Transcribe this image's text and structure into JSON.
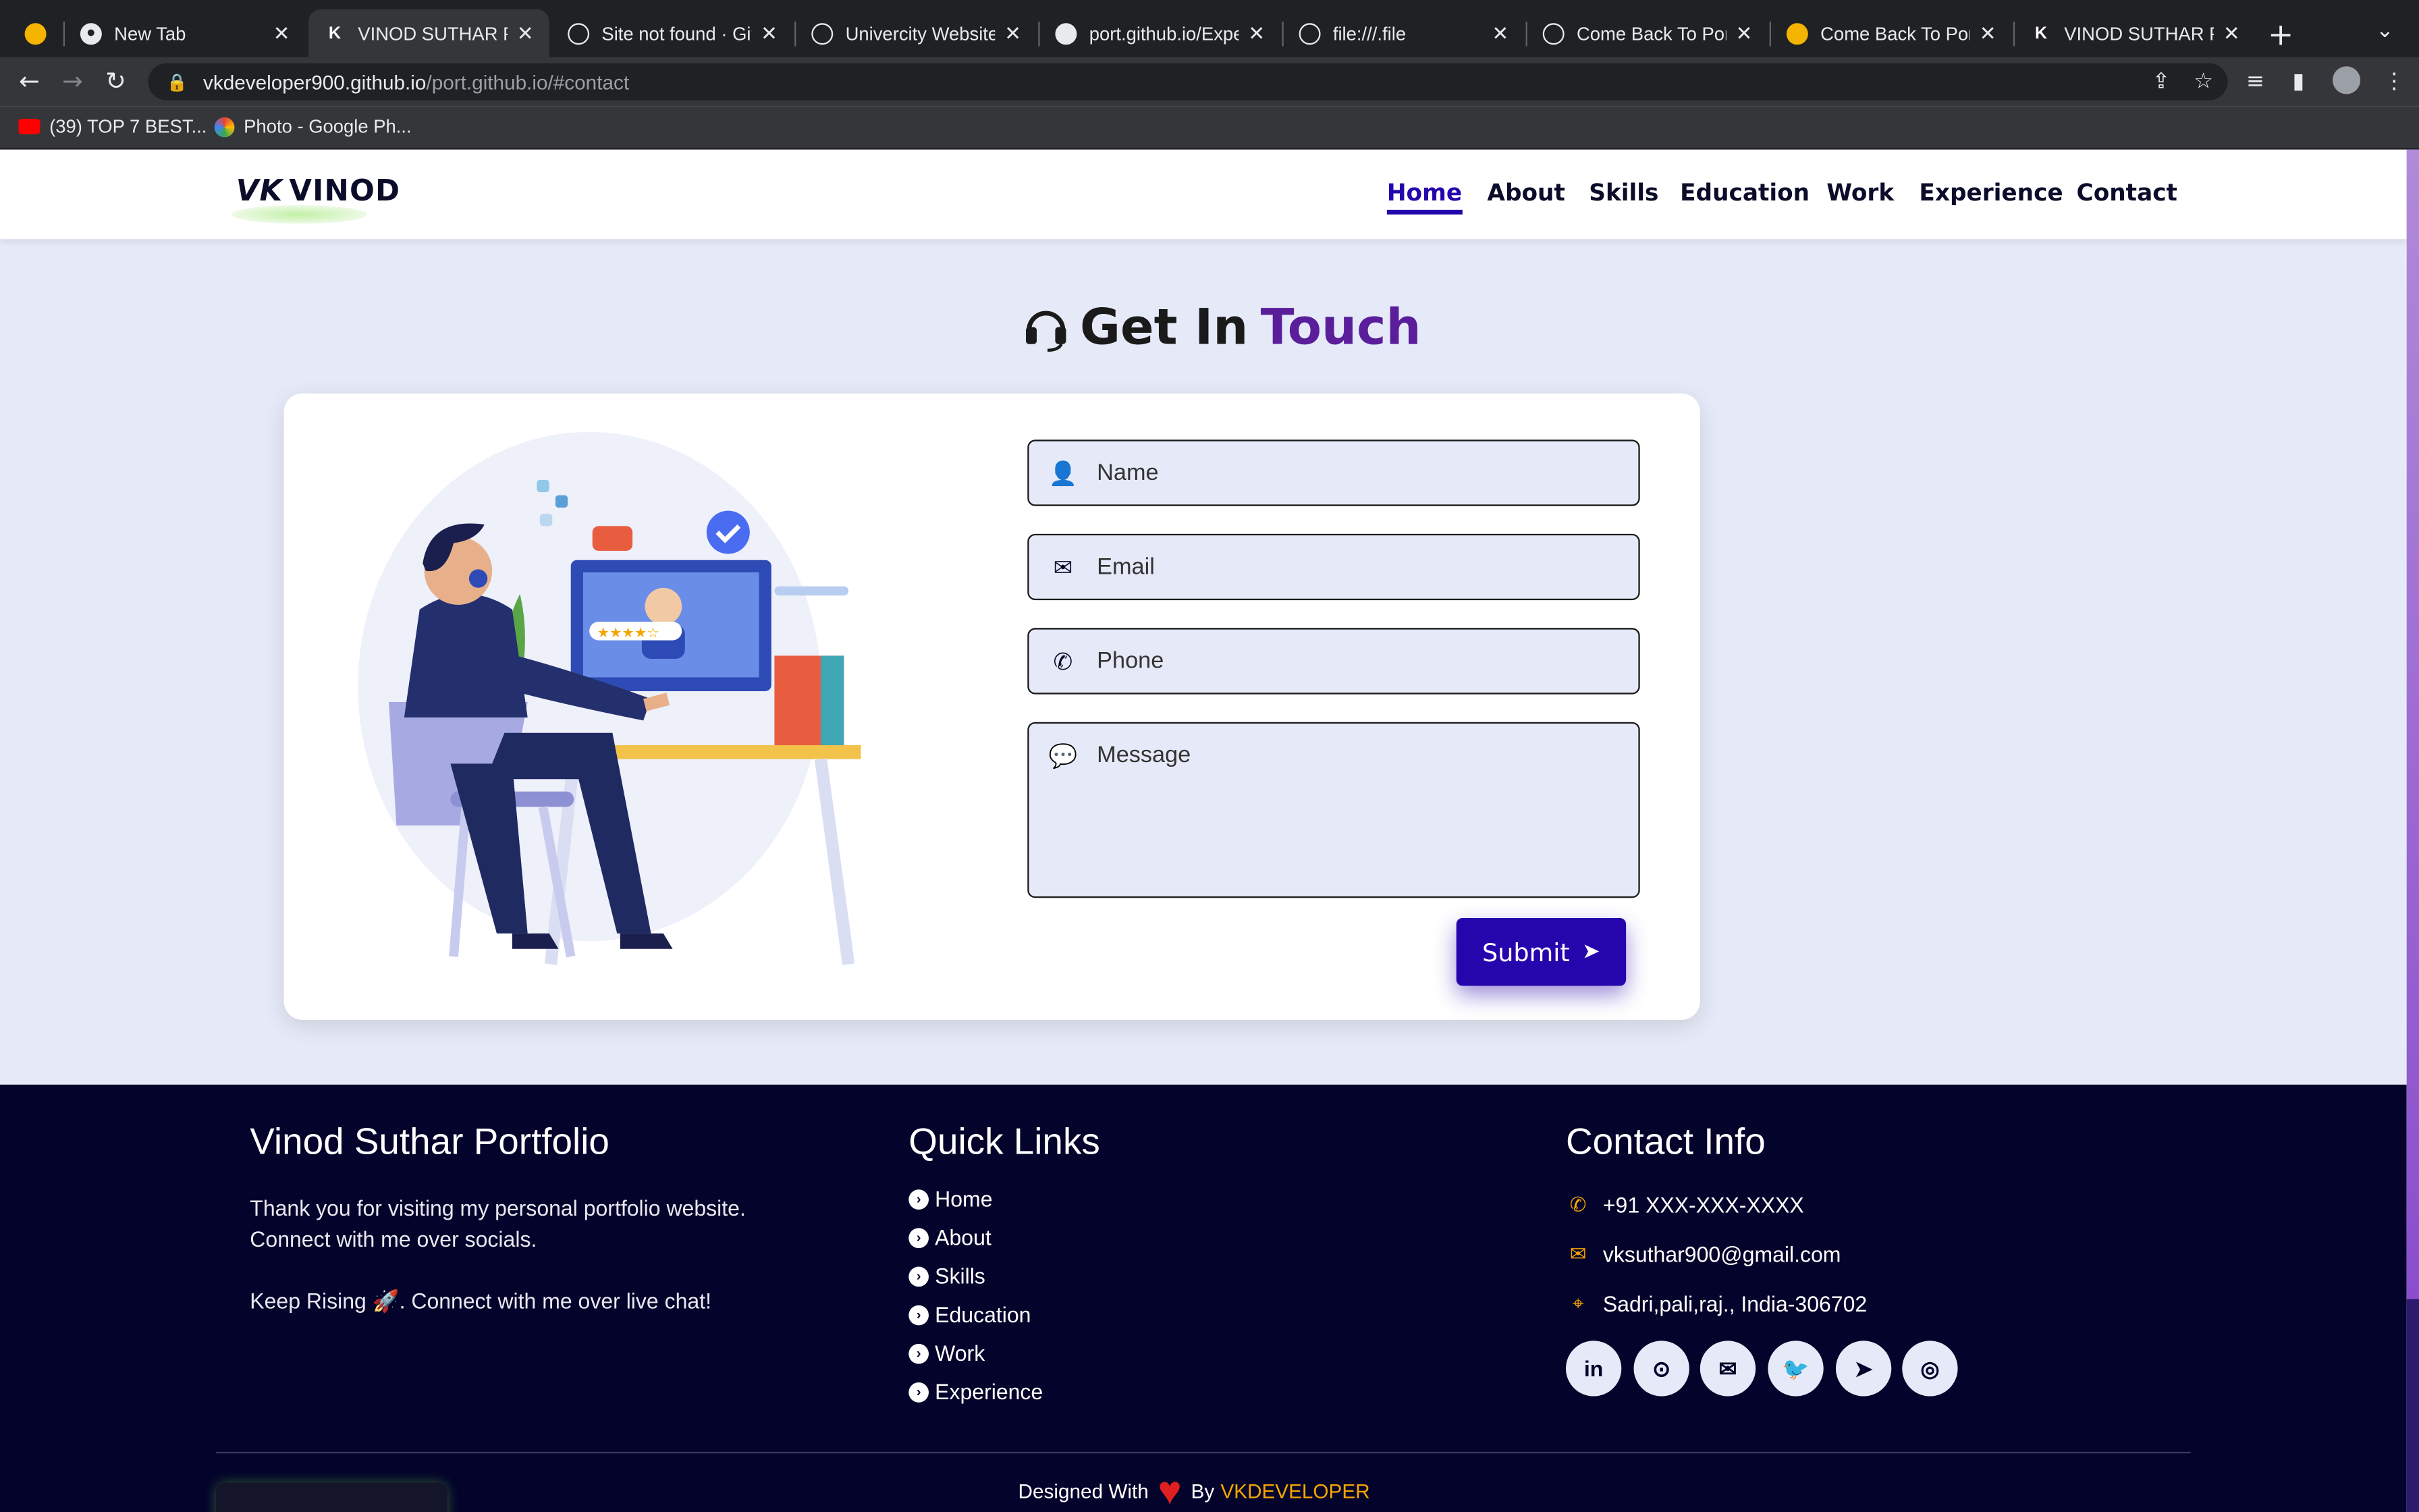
{
  "browser": {
    "tabs": [
      {
        "title": "",
        "active": false
      },
      {
        "title": "New Tab",
        "active": false
      },
      {
        "title": "VINOD SUTHAR POF",
        "active": true
      },
      {
        "title": "Site not found · GitH",
        "active": false
      },
      {
        "title": "Univercity Website D",
        "active": false
      },
      {
        "title": "port.github.io/Experi",
        "active": false
      },
      {
        "title": "file:///.file",
        "active": false
      },
      {
        "title": "Come Back To Portfo",
        "active": false
      },
      {
        "title": "Come Back To Portfo",
        "active": false
      },
      {
        "title": "VINOD SUTHAR POF",
        "active": false
      }
    ],
    "url_host": "vkdeveloper900.github.io",
    "url_path": "/port.github.io/#contact",
    "bookmarks": [
      {
        "label": "(39) TOP 7 BEST..."
      },
      {
        "label": "Photo - Google Ph..."
      }
    ]
  },
  "header": {
    "logo_mark": "VK",
    "logo_text": "VINOD",
    "nav": [
      {
        "label": "Home",
        "active": true
      },
      {
        "label": "About",
        "active": false
      },
      {
        "label": "Skills",
        "active": false
      },
      {
        "label": "Education",
        "active": false
      },
      {
        "label": "Work",
        "active": false
      },
      {
        "label": "Experience",
        "active": false
      },
      {
        "label": "Contact",
        "active": false
      }
    ]
  },
  "contact": {
    "heading_part1": "Get In",
    "heading_part2": "Touch",
    "fields": {
      "name_placeholder": "Name",
      "email_placeholder": "Email",
      "phone_placeholder": "Phone",
      "message_placeholder": "Message"
    },
    "submit_label": "Submit"
  },
  "footer": {
    "about_title": "Vinod Suthar Portfolio",
    "about_text1": "Thank you for visiting my personal portfolio website.",
    "about_text2": "Connect with me over socials.",
    "about_text3": "Keep Rising 🚀. Connect with me over live chat!",
    "links_title": "Quick Links",
    "links": [
      "Home",
      "About",
      "Skills",
      "Education",
      "Work",
      "Experience"
    ],
    "contact_title": "Contact Info",
    "phone": "+91 XXX-XXX-XXXX",
    "email": "vksuthar900@gmail.com",
    "address": "Sadri,pali,raj., India-306702",
    "socials": [
      {
        "icon": "linkedin-icon",
        "glyph": "in"
      },
      {
        "icon": "github-icon",
        "glyph": "⊙"
      },
      {
        "icon": "mail-icon",
        "glyph": "✉"
      },
      {
        "icon": "twitter-icon",
        "glyph": "🐦"
      },
      {
        "icon": "telegram-icon",
        "glyph": "➤"
      },
      {
        "icon": "instagram-icon",
        "glyph": "◎"
      }
    ],
    "credit_prefix": "Designed With",
    "credit_by": "By",
    "credit_author": "VKDEVELOPER"
  },
  "colors": {
    "accent": "#2506ad",
    "heading_accent": "#5a1e9b",
    "footer_bg": "#03032b",
    "section_bg": "#e6eaf8",
    "highlight": "#f7a600"
  }
}
